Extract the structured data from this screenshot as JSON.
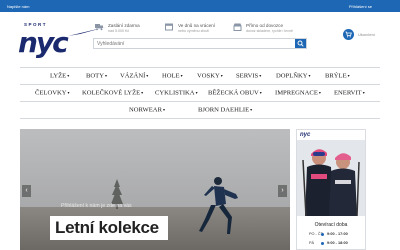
{
  "topbar": {
    "left_link": "Napište nám",
    "right_link": "Přihlášení se"
  },
  "logo": {
    "top_text": "SPORT",
    "main_text": "nyc"
  },
  "features": [
    {
      "icon": "truck-icon",
      "title": "Zaslání zdarma",
      "subtitle": "nad 5.000 Kč"
    },
    {
      "icon": "calendar-icon",
      "title": "Ve dnů na vrácení",
      "subtitle": "nebo výměnu zboží"
    },
    {
      "icon": "store-icon",
      "title": "Přímo od dovozce",
      "subtitle": "dovoz skladem, rychle i levně"
    }
  ],
  "search": {
    "placeholder": "Vyhledávání"
  },
  "cart": {
    "label": "Ukončení"
  },
  "nav": {
    "row1": [
      "LYŽE",
      "BOTY",
      "VÁZÁNÍ",
      "HOLE",
      "VOSKY",
      "SERVIS",
      "DOPLŇKY",
      "BRÝLE"
    ],
    "row2": [
      "ČELOVKY",
      "KOLEČKOVÉ LYŽE",
      "CYKLISTIKA",
      "BĚŽECKÁ OBUV",
      "IMPREGNACE",
      "ENERVIT"
    ],
    "row3": [
      "NORWEAR",
      "BJORN DAEHLIE"
    ]
  },
  "banner": {
    "subtitle": "Přihlášení k nám je zde na vás",
    "title": "Letní kolekce"
  },
  "side": {
    "mini_logo": "nyc",
    "hours_title": "Otevírací doba",
    "hours": [
      {
        "day": "PO - ČT",
        "time": "9:00 - 17:00"
      },
      {
        "day": "PÁ",
        "time": "9:00 - 18:00"
      }
    ]
  },
  "colors": {
    "brand_blue": "#1d67b5",
    "logo_navy": "#1b2a6e"
  }
}
